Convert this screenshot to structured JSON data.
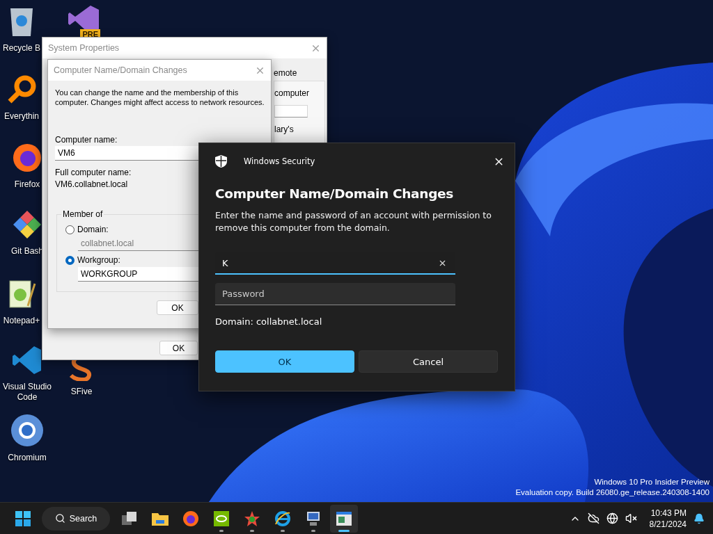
{
  "desktop_icons": [
    {
      "kind": "recycle",
      "label": "Recycle B"
    },
    {
      "kind": "everything",
      "label": "Everythin"
    },
    {
      "kind": "firefox",
      "label": "Firefox"
    },
    {
      "kind": "git",
      "label": "Git Bash"
    },
    {
      "kind": "notepad",
      "label": "Notepad+"
    },
    {
      "kind": "vscode",
      "label": "Visual Studio Code"
    },
    {
      "kind": "chromium",
      "label": "Chromium"
    },
    {
      "kind": "vs-preview",
      "badge": "PRE"
    },
    {
      "kind": "sfive",
      "label": "SFive"
    }
  ],
  "system_properties": {
    "title": "System Properties",
    "tab_label": "emote",
    "texts": [
      "computer",
      "lary's"
    ],
    "ok_button": "OK"
  },
  "name_changes_dialog": {
    "title": "Computer Name/Domain Changes",
    "description": "You can change the name and the membership of this computer. Changes might affect access to network resources.",
    "computer_name_label": "Computer name:",
    "computer_name": "VM6",
    "full_name_label": "Full computer name:",
    "full_name": "VM6.collabnet.local",
    "member_of": {
      "label": "Member of",
      "options": [
        {
          "label": "Domain:",
          "selected": false,
          "value": "collabnet.local"
        },
        {
          "label": "Workgroup:",
          "selected": true,
          "value": "WORKGROUP"
        }
      ]
    },
    "ok_button": "OK"
  },
  "security_dialog": {
    "app_name": "Windows Security",
    "title": "Computer Name/Domain Changes",
    "message": "Enter the name and password of an account with permission to remove this computer from the domain.",
    "fields": [
      {
        "value": "K",
        "focused": true
      },
      {
        "placeholder": "Password",
        "focused": false
      }
    ],
    "domain_note": "Domain: collabnet.local",
    "buttons": [
      {
        "label": "OK",
        "kind": "primary"
      },
      {
        "label": "Cancel",
        "kind": "secondary"
      }
    ]
  },
  "system_notice": [
    "Windows 10 Pro Insider Preview",
    "Evaluation copy. Build 26080.ge_release.240308-1400"
  ],
  "taskbar": {
    "search_label": "Search",
    "apps": [
      {
        "kind": "task-view",
        "running": false,
        "selected": false
      },
      {
        "kind": "folder",
        "running": false,
        "selected": false
      },
      {
        "kind": "firefox",
        "running": false,
        "selected": false
      },
      {
        "kind": "nvidia",
        "running": true,
        "selected": false
      },
      {
        "kind": "paint",
        "running": true,
        "selected": false
      },
      {
        "kind": "ie",
        "running": true,
        "selected": false
      },
      {
        "kind": "monitor",
        "running": true,
        "selected": false
      },
      {
        "kind": "sysprops",
        "running": true,
        "selected": true
      }
    ],
    "clock": {
      "time": "10:43 PM",
      "date": "8/21/2024"
    }
  }
}
